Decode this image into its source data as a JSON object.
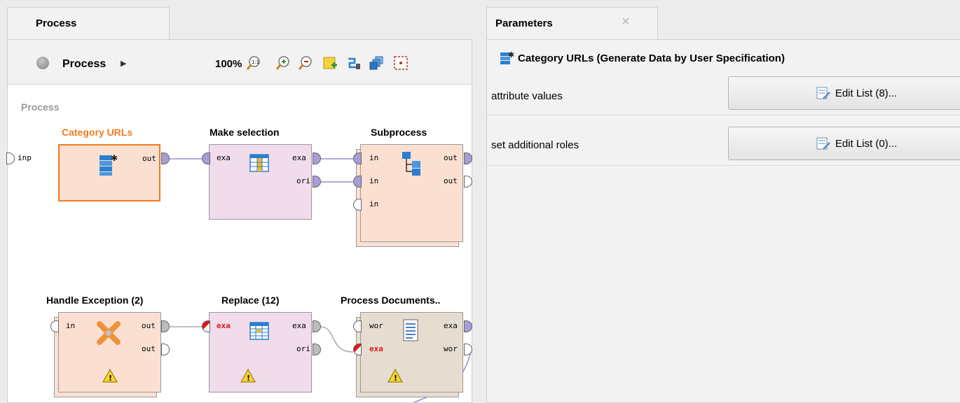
{
  "process_tab": {
    "label": "Process"
  },
  "toolbar": {
    "breadcrumb": "Process",
    "zoom": "100%",
    "icons": [
      "zoom-reset-icon",
      "zoom-in-icon",
      "zoom-out-icon",
      "add-note-icon",
      "auto-wire-icon",
      "arrange-icon",
      "fit-icon"
    ]
  },
  "canvas": {
    "title": "Process",
    "inp_label": "inp",
    "operators": {
      "category_urls": {
        "name": "Category URLs",
        "ports_out": [
          "out"
        ]
      },
      "make_selection": {
        "name": "Make selection",
        "ports_in": [
          "exa"
        ],
        "ports_out": [
          "exa",
          "ori"
        ]
      },
      "subprocess": {
        "name": "Subprocess",
        "ports_in": [
          "in",
          "in",
          "in"
        ],
        "ports_out": [
          "out",
          "out"
        ]
      },
      "handle_exception": {
        "name": "Handle Exception (2)",
        "ports_in": [
          "in"
        ],
        "ports_out": [
          "out",
          "out"
        ]
      },
      "replace": {
        "name": "Replace (12)",
        "ports_in": [
          "exa"
        ],
        "ports_out": [
          "exa",
          "ori"
        ]
      },
      "process_documents": {
        "name": "Process Documents..",
        "ports_in": [
          "wor",
          "exa"
        ],
        "ports_out": [
          "exa",
          "wor"
        ]
      }
    }
  },
  "parameters_tab": {
    "label": "Parameters",
    "close": "×"
  },
  "parameters": {
    "operator_title": "Category URLs (Generate Data by User Specification)",
    "rows": [
      {
        "label": "attribute values",
        "button": "Edit List (8)..."
      },
      {
        "label": "set additional roles",
        "button": "Edit List (0)..."
      }
    ]
  },
  "colors": {
    "selected_operator": "#f07b20",
    "operator_orange_fill": "#fbe0d2",
    "operator_purple_fill": "#f0dcea",
    "operator_brown_fill": "#e6ddd0",
    "port_purple": "#a99cd8",
    "error_red": "#e0181e"
  }
}
